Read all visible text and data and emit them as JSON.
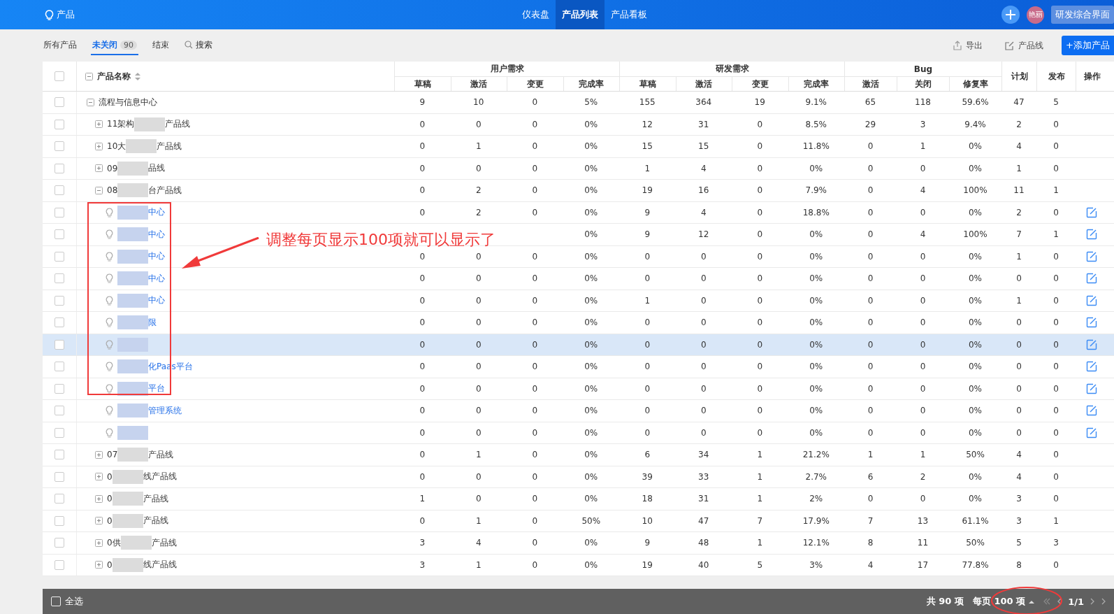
{
  "top_bar": {
    "app_title": "产品",
    "nav": [
      {
        "label": "仪表盘",
        "selected": false
      },
      {
        "label": "产品列表",
        "selected": true
      },
      {
        "label": "产品看板",
        "selected": false
      }
    ],
    "avatar": "艳丽",
    "workspace_button": "研发综合界面"
  },
  "toolbar": {
    "tabs": [
      {
        "label": "所有产品",
        "selected": false
      },
      {
        "label": "未关闭",
        "selected": true,
        "count": "90"
      },
      {
        "label": "结束",
        "selected": false
      }
    ],
    "search": "搜索",
    "actions": [
      "导出",
      "产品线"
    ],
    "add_button": "+添加产品"
  },
  "table": {
    "header_checked": false,
    "name_header": "产品名称",
    "groups": [
      {
        "label": "用户需求",
        "columns": [
          "草稿",
          "激活",
          "变更",
          "完成率"
        ]
      },
      {
        "label": "研发需求",
        "columns": [
          "草稿",
          "激活",
          "变更",
          "完成率"
        ]
      },
      {
        "label": "Bug",
        "columns": [
          "激活",
          "关闭",
          "修复率"
        ]
      }
    ],
    "extra_columns": [
      "计划",
      "发布",
      "操作"
    ],
    "rows": [
      {
        "kind": "group",
        "name_before": "流程与信息中心",
        "redacted": false,
        "expanded": true,
        "checked": false,
        "highlighted": false,
        "values": [
          "9",
          "10",
          "0",
          "5%",
          "155",
          "364",
          "19",
          "9.1%",
          "65",
          "118",
          "59.6%",
          "47",
          "5"
        ],
        "children": [
          {
            "kind": "group",
            "name_before": "11架构",
            "name_after": "产品线",
            "redacted": true,
            "expanded": false,
            "checked": false,
            "highlighted": false,
            "values": [
              "0",
              "0",
              "0",
              "0%",
              "12",
              "31",
              "0",
              "8.5%",
              "29",
              "3",
              "9.4%",
              "2",
              "0"
            ]
          },
          {
            "kind": "group",
            "name_before": "10大",
            "name_after": "产品线",
            "redacted": true,
            "expanded": false,
            "checked": false,
            "highlighted": false,
            "values": [
              "0",
              "1",
              "0",
              "0%",
              "15",
              "15",
              "0",
              "11.8%",
              "0",
              "1",
              "0%",
              "4",
              "0"
            ]
          },
          {
            "kind": "group",
            "name_before": "09",
            "name_after": "品线",
            "redacted": true,
            "expanded": false,
            "checked": false,
            "highlighted": false,
            "values": [
              "0",
              "0",
              "0",
              "0%",
              "1",
              "4",
              "0",
              "0%",
              "0",
              "0",
              "0%",
              "1",
              "0"
            ]
          },
          {
            "kind": "group",
            "name_before": "08",
            "name_after": "台产品线",
            "redacted": true,
            "expanded": true,
            "checked": false,
            "highlighted": false,
            "values": [
              "0",
              "2",
              "0",
              "0%",
              "19",
              "16",
              "0",
              "7.9%",
              "0",
              "4",
              "100%",
              "11",
              "1"
            ],
            "children": [
              {
                "kind": "product",
                "name_after": "中心",
                "redacted": true,
                "checked": false,
                "highlighted": false,
                "values": [
                  "0",
                  "2",
                  "0",
                  "0%",
                  "9",
                  "4",
                  "0",
                  "18.8%",
                  "0",
                  "0",
                  "0%",
                  "2",
                  "0"
                ]
              },
              {
                "kind": "product",
                "name_after": "中心",
                "redacted": true,
                "checked": false,
                "highlighted": false,
                "values": [
                  "0%",
                  "9",
                  "12",
                  "0",
                  "0%",
                  "0",
                  "4",
                  "100%",
                  "7",
                  "1"
                ]
              },
              {
                "kind": "product",
                "name_after": "中心",
                "redacted": true,
                "checked": false,
                "highlighted": false,
                "values": [
                  "0",
                  "0",
                  "0",
                  "0%",
                  "0",
                  "0",
                  "0",
                  "0%",
                  "0",
                  "0",
                  "0%",
                  "1",
                  "0"
                ]
              },
              {
                "kind": "product",
                "name_after": "中心",
                "redacted": true,
                "checked": false,
                "highlighted": false,
                "values": [
                  "0",
                  "0",
                  "0",
                  "0%",
                  "0",
                  "0",
                  "0",
                  "0%",
                  "0",
                  "0",
                  "0%",
                  "0",
                  "0"
                ]
              },
              {
                "kind": "product",
                "name_after": "中心",
                "redacted": true,
                "checked": false,
                "highlighted": false,
                "values": [
                  "0",
                  "0",
                  "0",
                  "0%",
                  "1",
                  "0",
                  "0",
                  "0%",
                  "0",
                  "0",
                  "0%",
                  "1",
                  "0"
                ]
              },
              {
                "kind": "product",
                "name_after": "限",
                "redacted": true,
                "checked": false,
                "highlighted": false,
                "values": [
                  "0",
                  "0",
                  "0",
                  "0%",
                  "0",
                  "0",
                  "0",
                  "0%",
                  "0",
                  "0",
                  "0%",
                  "0",
                  "0"
                ]
              },
              {
                "kind": "product",
                "redacted": true,
                "checked": false,
                "highlighted": true,
                "values": [
                  "0",
                  "0",
                  "0",
                  "0%",
                  "0",
                  "0",
                  "0",
                  "0%",
                  "0",
                  "0",
                  "0%",
                  "0",
                  "0"
                ]
              },
              {
                "kind": "product",
                "name_after": "化Paas平台",
                "redacted": true,
                "checked": false,
                "highlighted": false,
                "values": [
                  "0",
                  "0",
                  "0",
                  "0%",
                  "0",
                  "0",
                  "0",
                  "0%",
                  "0",
                  "0",
                  "0%",
                  "0",
                  "0"
                ]
              },
              {
                "kind": "product",
                "name_after": "平台",
                "redacted": true,
                "checked": false,
                "highlighted": false,
                "values": [
                  "0",
                  "0",
                  "0",
                  "0%",
                  "0",
                  "0",
                  "0",
                  "0%",
                  "0",
                  "0",
                  "0%",
                  "0",
                  "0"
                ]
              },
              {
                "kind": "product",
                "name_after": "管理系统",
                "redacted": true,
                "checked": false,
                "highlighted": false,
                "values": [
                  "0",
                  "0",
                  "0",
                  "0%",
                  "0",
                  "0",
                  "0",
                  "0%",
                  "0",
                  "0",
                  "0%",
                  "0",
                  "0"
                ]
              },
              {
                "kind": "product",
                "redacted": true,
                "checked": false,
                "highlighted": false,
                "values": [
                  "0",
                  "0",
                  "0",
                  "0%",
                  "0",
                  "0",
                  "0",
                  "0%",
                  "0",
                  "0",
                  "0%",
                  "0",
                  "0"
                ]
              }
            ]
          },
          {
            "kind": "group",
            "name_before": "07",
            "name_after": "产品线",
            "redacted": true,
            "expanded": false,
            "checked": false,
            "highlighted": false,
            "values": [
              "0",
              "1",
              "0",
              "0%",
              "6",
              "34",
              "1",
              "21.2%",
              "1",
              "1",
              "50%",
              "4",
              "0"
            ]
          },
          {
            "kind": "group",
            "name_before": "0",
            "name_after": "线产品线",
            "redacted": true,
            "expanded": false,
            "checked": false,
            "highlighted": false,
            "values": [
              "0",
              "0",
              "0",
              "0%",
              "39",
              "33",
              "1",
              "2.7%",
              "6",
              "2",
              "0%",
              "4",
              "0"
            ]
          },
          {
            "kind": "group",
            "name_before": "0",
            "name_after": "产品线",
            "redacted": true,
            "expanded": false,
            "checked": false,
            "highlighted": false,
            "values": [
              "1",
              "0",
              "0",
              "0%",
              "18",
              "31",
              "1",
              "2%",
              "0",
              "0",
              "0%",
              "3",
              "0"
            ]
          },
          {
            "kind": "group",
            "name_before": "0",
            "name_after": "产品线",
            "redacted": true,
            "expanded": false,
            "checked": false,
            "highlighted": false,
            "values": [
              "0",
              "1",
              "0",
              "50%",
              "10",
              "47",
              "7",
              "17.9%",
              "7",
              "13",
              "61.1%",
              "3",
              "1"
            ]
          },
          {
            "kind": "group",
            "name_before": "0供",
            "name_after": "产品线",
            "redacted": true,
            "expanded": false,
            "checked": false,
            "highlighted": false,
            "values": [
              "3",
              "4",
              "0",
              "0%",
              "9",
              "48",
              "1",
              "12.1%",
              "8",
              "11",
              "50%",
              "5",
              "3"
            ]
          },
          {
            "kind": "group",
            "name_before": "0",
            "name_after": "线产品线",
            "redacted": true,
            "expanded": false,
            "checked": false,
            "highlighted": false,
            "values": [
              "3",
              "1",
              "0",
              "0%",
              "19",
              "40",
              "5",
              "3%",
              "4",
              "17",
              "77.8%",
              "8",
              "0"
            ]
          }
        ]
      }
    ]
  },
  "footer": {
    "select_all": "全选",
    "select_all_checked": false,
    "total": "共 90 项",
    "page_size": "每页 100 项",
    "page": "1/1"
  },
  "annotation": {
    "note": "调整每页显示100项就可以显示了"
  }
}
